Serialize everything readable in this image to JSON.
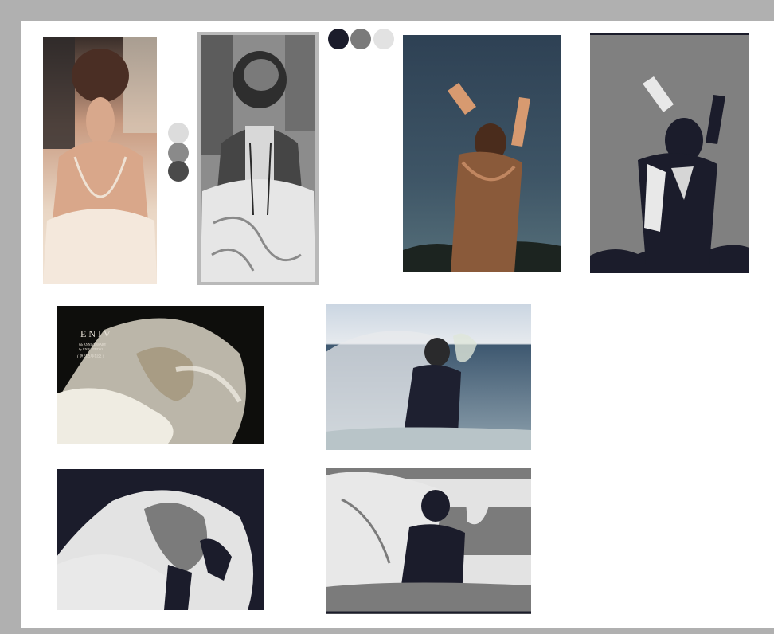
{
  "board": {
    "background": "#b0b0b0",
    "canvas_color": "#ffffff"
  },
  "palette_top": [
    "#1b1c2b",
    "#7a7a7a",
    "#e2e2e2"
  ],
  "palette_side": [
    "#dcdcdc",
    "#8a8a8a",
    "#4a4a4a"
  ],
  "photo_veil": {
    "logo": "ENIV",
    "line1": "6th ANNIVERSARY",
    "line2": "by ENIV STUDIO",
    "line3": "( 앤티스튜디오 )"
  },
  "colors": {
    "navy": "#1b1c2b",
    "mid_grey": "#7b7b7b",
    "light_grey": "#e3e3e3",
    "dark_grey": "#555555"
  }
}
